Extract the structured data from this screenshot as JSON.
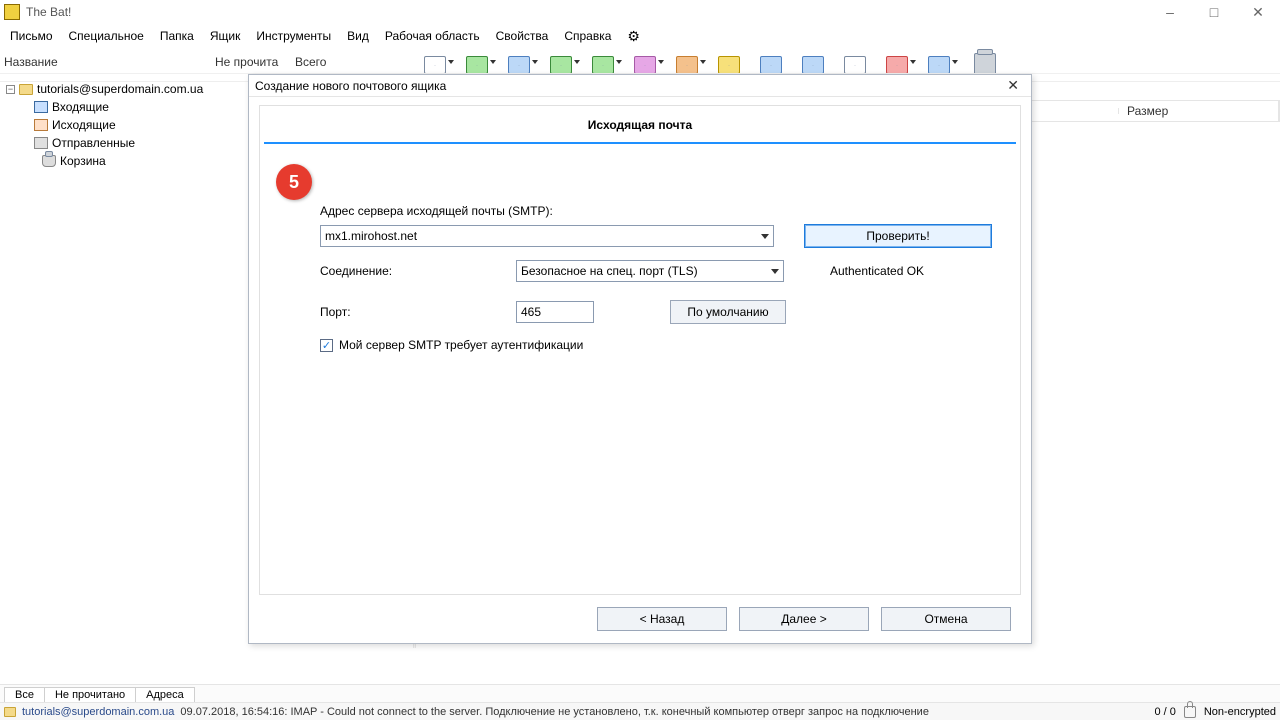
{
  "app": {
    "title": "The Bat!"
  },
  "menu": {
    "items": [
      "Письмо",
      "Специальное",
      "Папка",
      "Ящик",
      "Инструменты",
      "Вид",
      "Рабочая область",
      "Свойства",
      "Справка"
    ]
  },
  "nav_header": {
    "name": "Название",
    "unread": "Не прочита",
    "total": "Всего"
  },
  "tree": {
    "account": "tutorials@superdomain.com.ua",
    "folders": [
      "Входящие",
      "Исходящие",
      "Отправленные",
      "Корзина"
    ]
  },
  "list_headers": {
    "size": "Размер"
  },
  "dialog": {
    "title": "Создание нового почтового ящика",
    "section": "Исходящая почта",
    "labels": {
      "smtp": "Адрес сервера исходящей почты (SMTP):",
      "connection": "Соединение:",
      "port": "Порт:",
      "auth_required": "Мой сервер SMTP требует аутентификации"
    },
    "fields": {
      "smtp_server": "mx1.mirohost.net",
      "connection": "Безопасное на спец. порт (TLS)",
      "port": "465",
      "auth_checked": true
    },
    "buttons": {
      "check": "Проверить!",
      "default": "По умолчанию",
      "back": "<  Назад",
      "next": "Далее   >",
      "cancel": "Отмена"
    },
    "status": "Authenticated OK",
    "step_badge": "5"
  },
  "bottom_tabs": [
    "Все",
    "Не прочитано",
    "Адреса"
  ],
  "status": {
    "email": "tutorials@superdomain.com.ua",
    "message": "09.07.2018, 16:54:16: IMAP  - Could not connect to the server. Подключение не установлено, т.к. конечный компьютер отверг запрос на подключение",
    "counter": "0 / 0",
    "encryption": "Non-encrypted"
  }
}
